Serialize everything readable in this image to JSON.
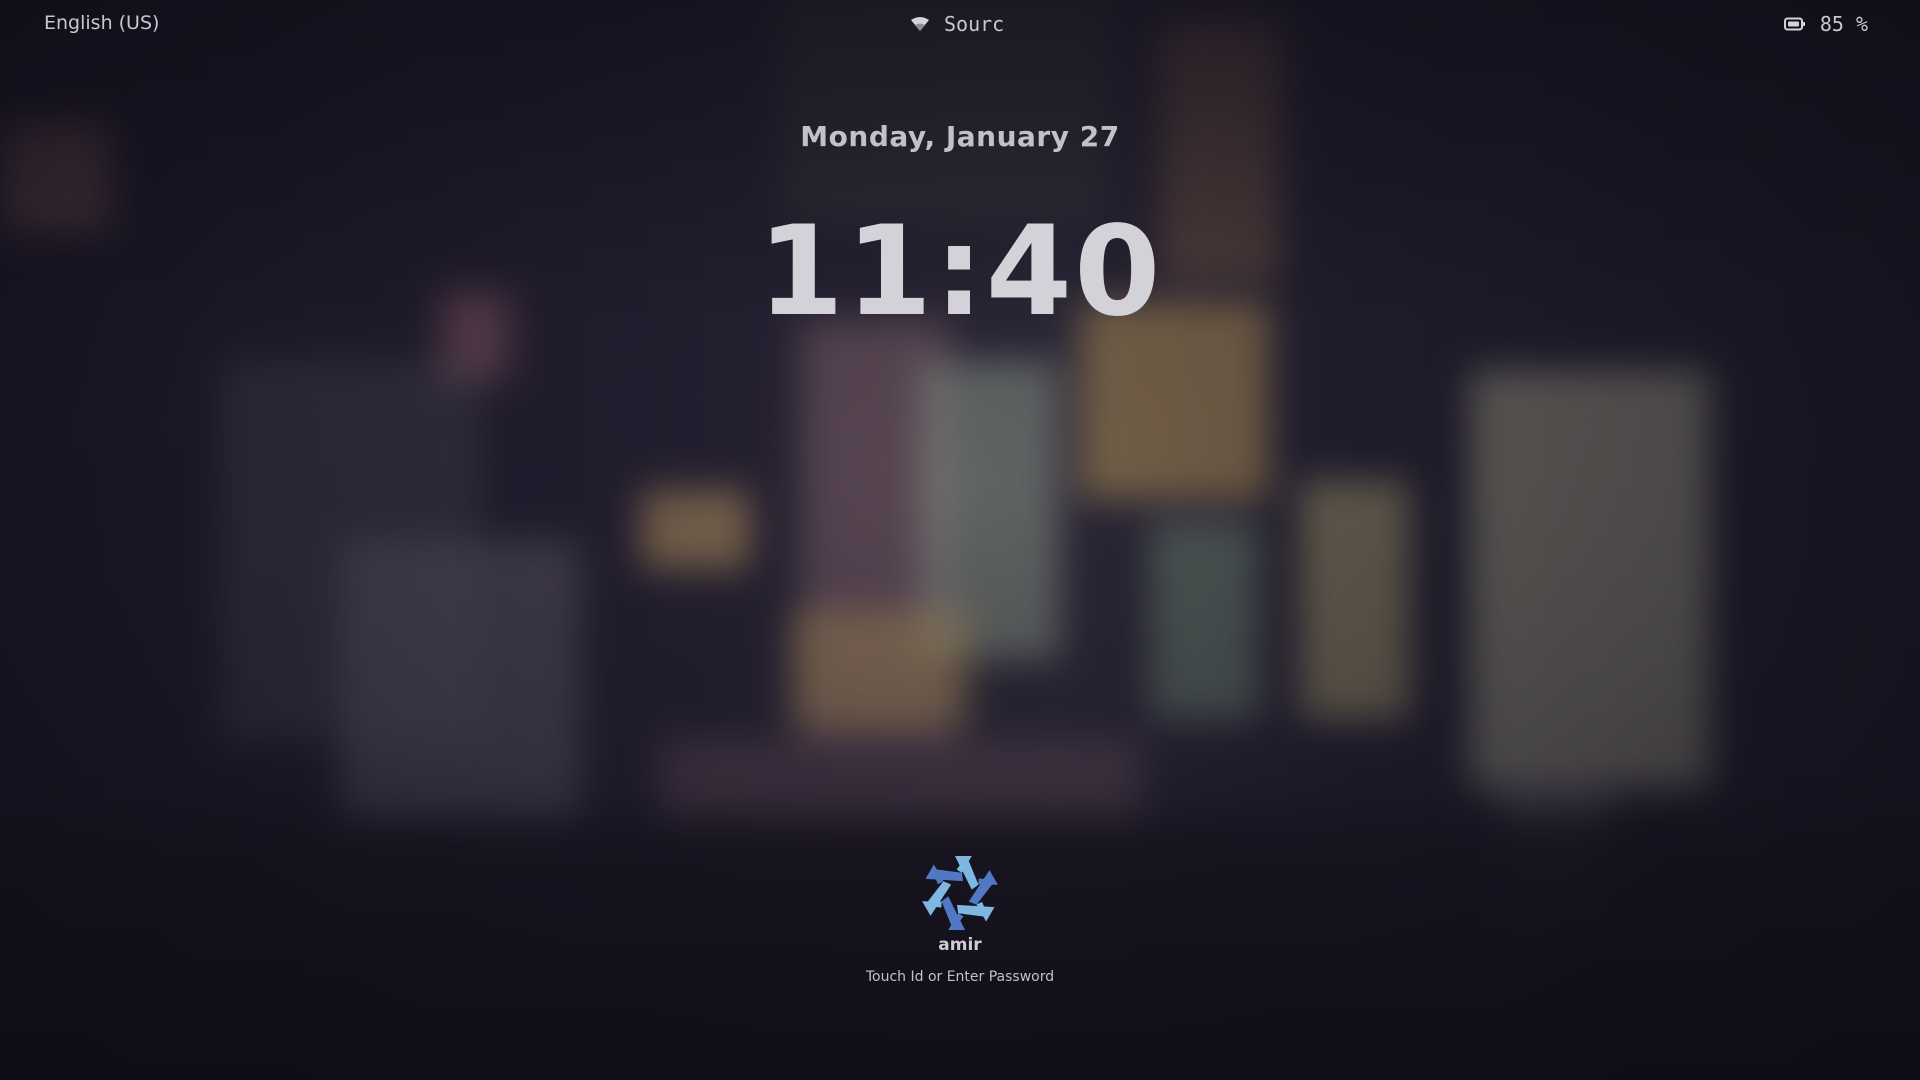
{
  "topbar": {
    "keyboard_layout": "English (US)",
    "network_name": "Sourc",
    "network_icon": "wifi-icon",
    "battery_level": "85 %",
    "battery_icon": "battery-icon"
  },
  "clock": {
    "date": "Monday, January 27",
    "time": "11:40"
  },
  "user": {
    "avatar_icon": "nixos-snowflake-icon",
    "name": "amir",
    "prompt": "Touch Id or Enter Password"
  },
  "colors": {
    "accent_light": "#7eb7e2",
    "accent_dark": "#5277c3"
  }
}
